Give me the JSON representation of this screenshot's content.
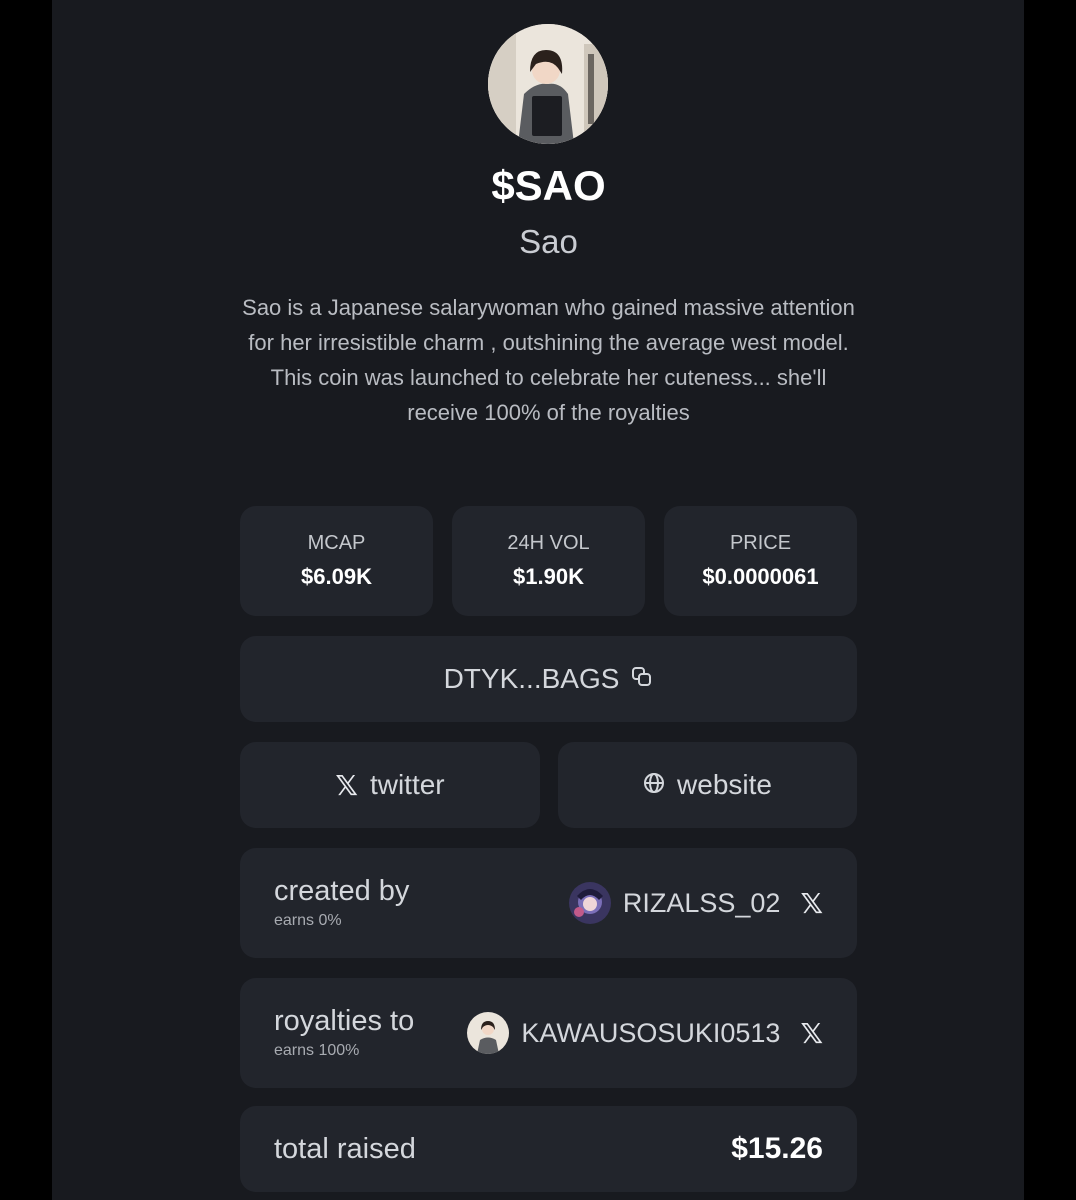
{
  "token": {
    "ticker": "$SAO",
    "name": "Sao",
    "description": "Sao is a Japanese salarywoman who gained massive attention for her irresistible charm , outshining the average west model. This coin was launched to celebrate her cuteness... she'll receive 100% of the royalties",
    "avatar_icon": "profile-photo"
  },
  "stats": [
    {
      "label": "MCAP",
      "value": "$6.09K"
    },
    {
      "label": "24H VOL",
      "value": "$1.90K"
    },
    {
      "label": "PRICE",
      "value": "$0.0000061"
    }
  ],
  "contract": {
    "short_address": "DTYK...BAGS",
    "copy_icon": "copy-icon"
  },
  "links": {
    "twitter_label": "twitter",
    "twitter_icon": "x-icon",
    "website_label": "website",
    "website_icon": "globe-icon"
  },
  "creator": {
    "title": "created by",
    "earns": "earns 0%",
    "username": "RIZALSS_02",
    "social_icon": "x-icon"
  },
  "royalties": {
    "title": "royalties to",
    "earns": "earns 100%",
    "username": "KAWAUSOSUKI0513",
    "social_icon": "x-icon"
  },
  "total": {
    "label": "total raised",
    "value": "$15.26"
  },
  "colors": {
    "page_background": "#181a1f",
    "card_background": "#22252c",
    "outer_background": "#000000",
    "text_primary": "#ffffff",
    "text_secondary": "#b9bcc2"
  }
}
